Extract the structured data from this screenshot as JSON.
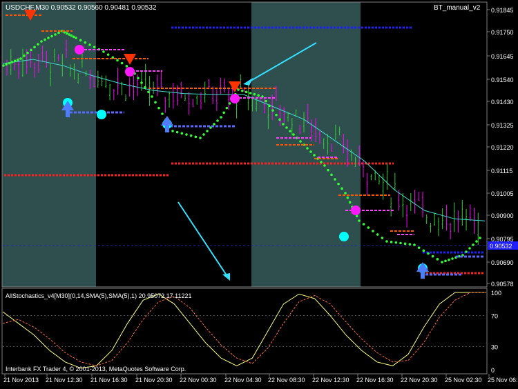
{
  "window": {
    "header": "USDCHF,M30  0.90532 0.90560 0.90481 0.90532",
    "indicator_title": "BT_manual_v2",
    "copyright": "Interbank FX Trader 4, © 2001-2013, MetaQuotes Software Corp."
  },
  "chart_data": [
    {
      "type": "candlestick",
      "symbol": "USDCHF",
      "timeframe": "M30",
      "ohlc_last": {
        "open": 0.90532,
        "high": 0.9056,
        "low": 0.90481,
        "close": 0.90532
      },
      "y_ticks": [
        "0.91845",
        "0.91750",
        "0.91645",
        "0.91540",
        "0.91430",
        "0.91325",
        "0.91220",
        "0.91115",
        "0.91005",
        "0.90900",
        "0.90795",
        "0.90690",
        "0.90578"
      ],
      "ylim": [
        0.90578,
        0.919
      ],
      "current_price_label": "0.90532",
      "x_ticks": [
        "21 Nov 2013",
        "21 Nov 12:30",
        "21 Nov 16:30",
        "21 Nov 20:30",
        "22 Nov 00:30",
        "22 Nov 04:30",
        "22 Nov 08:30",
        "22 Nov 12:30",
        "22 Nov 16:30",
        "22 Nov 20:30",
        "25 Nov 02:30",
        "25 Nov 06:30"
      ],
      "moving_average": [
        0.9164,
        0.9166,
        0.9163,
        0.9158,
        0.9154,
        0.9151,
        0.91495,
        0.9149,
        0.9149,
        0.9143,
        0.9137,
        0.9127,
        0.9117,
        0.9103,
        0.9093,
        0.9089,
        0.9088
      ],
      "levels": [
        {
          "price": 0.9178,
          "color": "#1f1fff"
        },
        {
          "price": 0.91135,
          "color": "#ff1f1f"
        },
        {
          "price": 0.91105,
          "color": "#ff1f1f"
        },
        {
          "price": 0.9072,
          "color": "#ff1f1f"
        },
        {
          "price": 0.9074,
          "color": "#1f1fff"
        }
      ]
    },
    {
      "type": "line",
      "title": "AllStochastics_v4[M30](0,14,SMA(5),SMA(5),1) 20.95072 17.11221",
      "y_ticks": [
        "100",
        "70",
        "30",
        "0"
      ],
      "ylim": [
        0,
        100
      ],
      "series": [
        {
          "values": [
            75,
            60,
            45,
            25,
            10,
            2,
            5,
            25,
            60,
            90,
            98,
            85,
            60,
            35,
            15,
            5,
            15,
            50,
            85,
            98,
            92,
            70,
            45,
            25,
            10,
            5,
            20,
            55,
            85,
            100,
            100,
            100
          ]
        },
        {
          "values": [
            60,
            65,
            55,
            40,
            22,
            10,
            5,
            12,
            35,
            65,
            88,
            95,
            80,
            55,
            32,
            15,
            8,
            28,
            60,
            88,
            96,
            85,
            62,
            40,
            22,
            10,
            12,
            35,
            68,
            90,
            100,
            100
          ]
        }
      ]
    }
  ],
  "colors": {
    "background": "#000000",
    "session_shade": "#2f4f4f",
    "candle_up": "#32cd32",
    "candle_down": "#ff00ff",
    "ma_line": "#40e0d0",
    "stoch_main": "#ffff80",
    "stoch_signal": "#ff6a3a",
    "grid_frame": "#808080",
    "text": "#ffffff"
  }
}
